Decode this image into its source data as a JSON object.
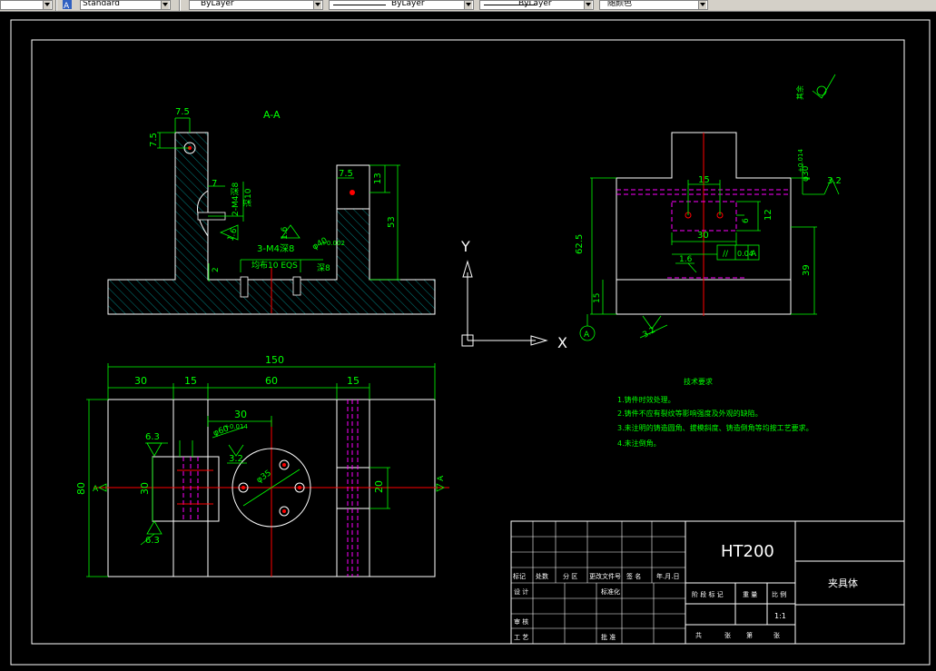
{
  "toolbar": {
    "text_style": "Standard",
    "layer": "ByLayer",
    "linetype": "ByLayer",
    "lineweight": "ByLayer",
    "color": "随颜色"
  },
  "drawing": {
    "section_label": "A-A",
    "section_dims": {
      "d7_5_left": "7.5",
      "d7_5_vert": "7.5",
      "d7": "7",
      "thread_2m4": "2-M4深8",
      "depth_10": "深10",
      "rough16a": "1.6",
      "rough16b": "1.6",
      "thread_3m4": "3-M4深8",
      "eqs": "均布10 EQS",
      "d2": "2",
      "d8": "深8",
      "phi40": "φ40",
      "tol002": "+0.002",
      "d7_5_right": "7.5",
      "d13": "13",
      "d53": "53"
    },
    "side_dims": {
      "d15": "15",
      "phi30": "φ30",
      "tol0014": "+0.014",
      "rough32": "3.2",
      "d6": "6",
      "d12": "12",
      "d30": "30",
      "d625": "62.5",
      "d39": "39",
      "rough16": "1.6",
      "gtol_symbol": "//",
      "gtol_value": "0.04",
      "gtol_datum": "A",
      "d15b": "15",
      "datum_a": "A",
      "rough32b": "3.2",
      "other_mark": "其余"
    },
    "plan_dims": {
      "d150": "150",
      "d30": "30",
      "d15a": "15",
      "d60": "60",
      "d15b": "15",
      "d30b": "30",
      "phi60": "φ60",
      "tol0014": "+0.014",
      "rough63a": "6.3",
      "rough32": "3.2",
      "d80": "80",
      "d30v": "30",
      "phi35": "φ35",
      "d20": "20",
      "rough63b": "6.3",
      "a_left": "A",
      "a_right": "A"
    },
    "axes": {
      "y": "Y",
      "x": "X"
    },
    "notes": {
      "title": "技术要求",
      "items": [
        "1.铸件时效处理。",
        "2.铸件不应有裂纹等影响强度及外观的缺陷。",
        "3.未注明的铸造圆角、拔模斜度、铸造倒角等均按工艺要求。",
        "4.未注倒角。"
      ]
    },
    "title_block": {
      "material": "HT200",
      "part_name": "夹具体",
      "row_labels": [
        "标记",
        "处数",
        "分 区",
        "更改文件号",
        "签 名",
        "年.月.日"
      ],
      "designer": "设 计",
      "standard": "标准化",
      "review": "审 核",
      "process": "工 艺",
      "approve": "批 准",
      "stage_labels": [
        "阶 段 标 记",
        "重 量",
        "比 例"
      ],
      "scale": "1:1",
      "sheet_labels": [
        "共",
        "张",
        "第",
        "张"
      ]
    }
  }
}
